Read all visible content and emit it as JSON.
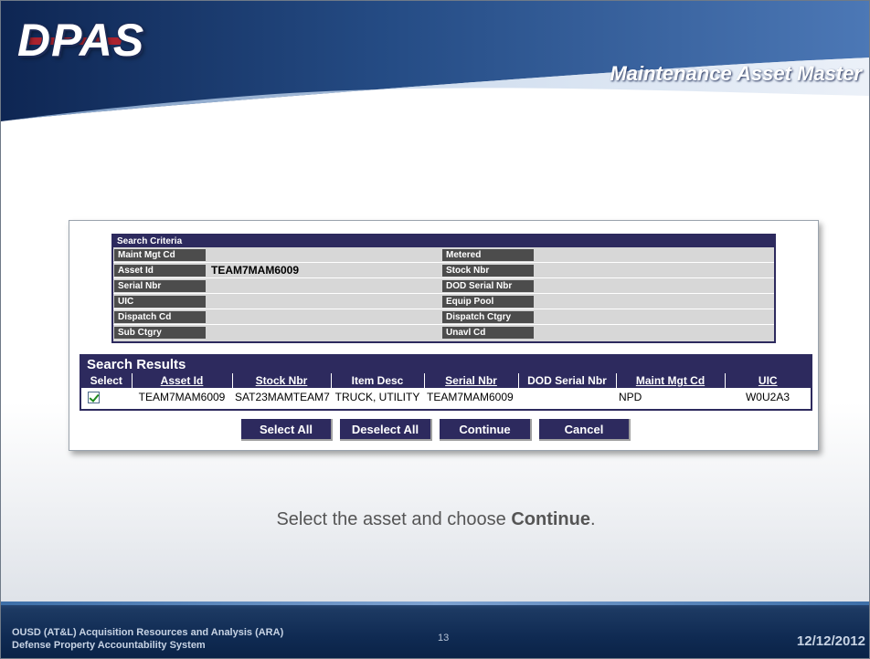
{
  "header": {
    "logo_text": "DPAS",
    "page_title": "Maintenance Asset Master"
  },
  "search_criteria": {
    "title": "Search Criteria",
    "left": [
      {
        "label": "Maint Mgt Cd",
        "value": ""
      },
      {
        "label": "Asset Id",
        "value": "TEAM7MAM6009"
      },
      {
        "label": "Serial Nbr",
        "value": ""
      },
      {
        "label": "UIC",
        "value": ""
      },
      {
        "label": "Dispatch Cd",
        "value": ""
      },
      {
        "label": "Sub Ctgry",
        "value": ""
      }
    ],
    "right": [
      {
        "label": "Metered",
        "value": ""
      },
      {
        "label": "Stock Nbr",
        "value": ""
      },
      {
        "label": "DOD Serial Nbr",
        "value": ""
      },
      {
        "label": "Equip Pool",
        "value": ""
      },
      {
        "label": "Dispatch Ctgry",
        "value": ""
      },
      {
        "label": "Unavl Cd",
        "value": ""
      }
    ]
  },
  "search_results": {
    "title": "Search Results",
    "columns": [
      "Select",
      "Asset Id",
      "Stock Nbr",
      "Item Desc",
      "Serial Nbr",
      "DOD Serial Nbr",
      "Maint Mgt Cd",
      "UIC"
    ],
    "rows": [
      {
        "selected": true,
        "asset_id": "TEAM7MAM6009",
        "stock_nbr": "SAT23MAMTEAM7",
        "item_desc": "TRUCK, UTILITY",
        "serial_nbr": "TEAM7MAM6009",
        "dod_serial_nbr": "",
        "maint_mgt_cd": "NPD",
        "uic": "W0U2A3"
      }
    ]
  },
  "buttons": {
    "select_all": "Select All",
    "deselect_all": "Deselect All",
    "continue": "Continue",
    "cancel": "Cancel"
  },
  "instruction": {
    "prefix": "Select the asset and choose ",
    "emphasis": "Continue",
    "suffix": "."
  },
  "footer": {
    "line1": "OUSD (AT&L) Acquisition Resources and Analysis (ARA)",
    "line2": "Defense Property Accountability System",
    "page_number": "13",
    "date": "12/12/2012"
  },
  "colors": {
    "accent_navy": "#2d2a5e",
    "label_gray": "#4c4c4c",
    "footer_blue": "#0f2a52"
  }
}
